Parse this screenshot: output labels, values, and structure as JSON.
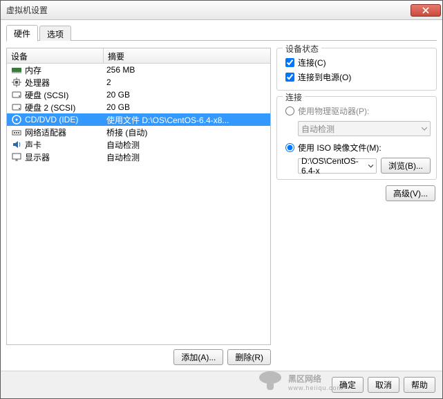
{
  "window": {
    "title": "虚拟机设置"
  },
  "tabs": [
    {
      "label": "硬件",
      "active": true
    },
    {
      "label": "选项",
      "active": false
    }
  ],
  "list": {
    "header": {
      "device": "设备",
      "summary": "摘要"
    },
    "rows": [
      {
        "icon": "memory",
        "device": "内存",
        "summary": "256 MB",
        "selected": false
      },
      {
        "icon": "cpu",
        "device": "处理器",
        "summary": "2",
        "selected": false
      },
      {
        "icon": "disk",
        "device": "硬盘 (SCSI)",
        "summary": "20 GB",
        "selected": false
      },
      {
        "icon": "disk",
        "device": "硬盘 2 (SCSI)",
        "summary": "20 GB",
        "selected": false
      },
      {
        "icon": "cd",
        "device": "CD/DVD (IDE)",
        "summary": "使用文件 D:\\OS\\CentOS-6.4-x8...",
        "selected": true
      },
      {
        "icon": "net",
        "device": "网络适配器",
        "summary": "桥接 (自动)",
        "selected": false
      },
      {
        "icon": "sound",
        "device": "声卡",
        "summary": "自动检测",
        "selected": false
      },
      {
        "icon": "display",
        "device": "显示器",
        "summary": "自动检测",
        "selected": false
      }
    ]
  },
  "buttons": {
    "add": "添加(A)...",
    "remove": "删除(R)",
    "browse": "浏览(B)...",
    "advanced": "高级(V)...",
    "ok": "确定",
    "cancel": "取消",
    "help": "帮助"
  },
  "right": {
    "status": {
      "title": "设备状态",
      "connected": "连接(C)",
      "connect_power": "连接到电源(O)"
    },
    "connection": {
      "title": "连接",
      "physical": "使用物理驱动器(P):",
      "autodetect": "自动检测",
      "iso": "使用 ISO 映像文件(M):",
      "iso_path": "D:\\OS\\CentOS-6.4-x"
    }
  },
  "watermark": {
    "main": "黑区网络",
    "sub": "www.heiiqu.com"
  }
}
